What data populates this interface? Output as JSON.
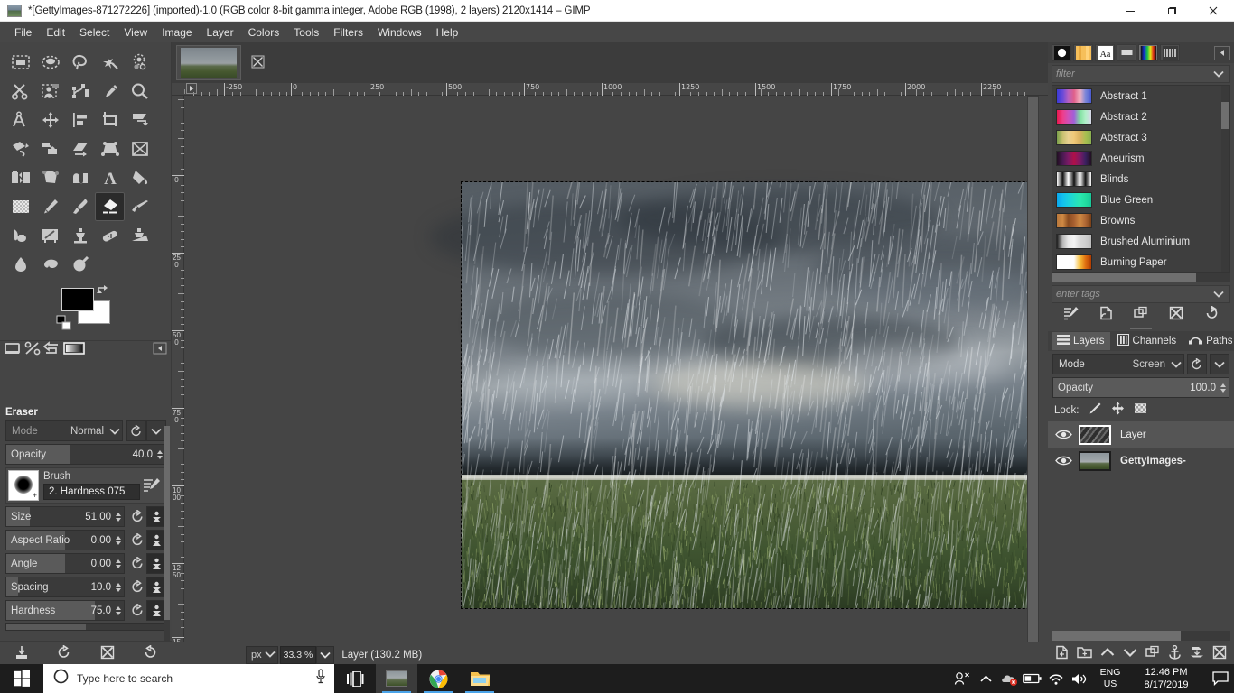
{
  "window": {
    "title": "*[GettyImages-871272226] (imported)-1.0 (RGB color 8-bit gamma integer, Adobe RGB (1998), 2 layers) 2120x1414 – GIMP",
    "minimize": "–",
    "maximize": "❐",
    "close": "✕"
  },
  "menubar": {
    "items": [
      "File",
      "Edit",
      "Select",
      "View",
      "Image",
      "Layer",
      "Colors",
      "Tools",
      "Filters",
      "Windows",
      "Help"
    ]
  },
  "toolbox": {
    "tools": [
      "rectangle-select",
      "ellipse-select",
      "free-select",
      "fuzzy-select",
      "select-by-color",
      "scissors-select",
      "foreground-select",
      "paths",
      "color-picker",
      "zoom",
      "measure",
      "move",
      "alignment",
      "crop",
      "transform",
      "rotate",
      "scale",
      "shear",
      "perspective",
      "3d-transform",
      "flip",
      "cage-transform",
      "warp-transform",
      "text",
      "bucket-fill",
      "gradient",
      "pencil",
      "paintbrush",
      "eraser",
      "airbrush",
      "ink",
      "mypaint-brush",
      "clone",
      "heal",
      "perspective-clone",
      "blur-sharpen",
      "smudge",
      "dodge-burn"
    ],
    "active_tool": "eraser",
    "foreground_color": "#000000",
    "background_color": "#ffffff"
  },
  "tool_options": {
    "title": "Eraser",
    "mode_label": "Mode",
    "mode_value": "Normal",
    "opacity_label": "Opacity",
    "opacity_value": "40.0",
    "opacity_percent": 40,
    "brush_caption": "Brush",
    "brush_name": "2. Hardness 075",
    "sliders": [
      {
        "label": "Size",
        "value": "51.00",
        "percent": 20
      },
      {
        "label": "Aspect Ratio",
        "value": "0.00",
        "percent": 50
      },
      {
        "label": "Angle",
        "value": "0.00",
        "percent": 50
      },
      {
        "label": "Spacing",
        "value": "10.0",
        "percent": 10
      },
      {
        "label": "Hardness",
        "value": "75.0",
        "percent": 75
      }
    ],
    "footer_buttons": [
      "save-tool-preset",
      "restore-tool-preset",
      "delete-tool-preset",
      "reset-tool-options"
    ]
  },
  "canvas": {
    "tab_title": "GettyImages-871272226",
    "ruler_h_labels": [
      "-250",
      "0",
      "250",
      "500",
      "750",
      "1000",
      "1250",
      "1500",
      "1750",
      "2000",
      "2250"
    ],
    "ruler_v_labels": [
      "0",
      "250",
      "500",
      "750",
      "1000",
      "1250",
      "15"
    ],
    "unit": "px",
    "zoom": "33.3 %",
    "status": "Layer (130.2 MB)"
  },
  "gradients_dock": {
    "tabs": [
      "brushes-icon",
      "patterns-icon",
      "fonts-icon",
      "buffers-icon",
      "gradients-icon",
      "palettes-icon"
    ],
    "selected_tab": "gradients-icon",
    "filter_placeholder": "filter",
    "tags_placeholder": "enter tags",
    "items": [
      {
        "name": "Abstract 1",
        "colors": [
          "#3a3ad6",
          "#6a4ad8",
          "#b760c0",
          "#e0608a",
          "#f0b0c0",
          "#7c86d8",
          "#4a5ad0"
        ]
      },
      {
        "name": "Abstract 2",
        "colors": [
          "#e81850",
          "#ee3e8a",
          "#d050b8",
          "#a060d8",
          "#7fe0a0",
          "#b0f0c8",
          "#d8d8e8"
        ]
      },
      {
        "name": "Abstract 3",
        "colors": [
          "#7aa04a",
          "#c8c070",
          "#e8d090",
          "#f0c878",
          "#d8b060",
          "#a8c050",
          "#8ab050"
        ]
      },
      {
        "name": "Aneurism",
        "colors": [
          "#221022",
          "#4a1a52",
          "#7a1a66",
          "#b01048",
          "#7a1a66",
          "#3a2060",
          "#221022"
        ]
      },
      {
        "name": "Blinds",
        "colors": [
          "#ffffff",
          "#101010",
          "#ffffff",
          "#101010",
          "#ffffff",
          "#101010",
          "#ffffff"
        ]
      },
      {
        "name": "Blue Green",
        "colors": [
          "#0aa8ee",
          "#12c0ee",
          "#1ad0e0",
          "#22ddc8",
          "#2ae8b0",
          "#22dda0",
          "#18c898"
        ]
      },
      {
        "name": "Browns",
        "colors": [
          "#b9783c",
          "#cf8a44",
          "#8a4c20",
          "#a86030",
          "#cf8a44",
          "#b06834",
          "#7a4018"
        ]
      },
      {
        "name": "Brushed Aluminium",
        "colors": [
          "#1c1c1c",
          "#b8b8b8",
          "#e8e8e8",
          "#f4f4f4",
          "#d8d8d8",
          "#cfcfcf",
          "#bdbdbd"
        ]
      },
      {
        "name": "Burning Paper",
        "colors": [
          "#ffffff",
          "#ffffff",
          "#ffffff",
          "#fdfdfd",
          "#f8c03a",
          "#e07010",
          "#b03c00"
        ]
      }
    ],
    "footer_buttons": [
      "edit-gradient",
      "new-gradient",
      "duplicate-gradient",
      "delete-gradient",
      "refresh-gradients"
    ]
  },
  "layers_dock": {
    "tabs": [
      {
        "label": "Layers",
        "icon": "layers-icon"
      },
      {
        "label": "Channels",
        "icon": "channels-icon"
      },
      {
        "label": "Paths",
        "icon": "paths-icon"
      }
    ],
    "selected_tab": "Layers",
    "mode_label": "Mode",
    "mode_value": "Screen",
    "opacity_label": "Opacity",
    "opacity_value": "100.0",
    "lock_label": "Lock:",
    "lock_options": [
      "lock-pixels-icon",
      "lock-position-icon",
      "lock-alpha-icon"
    ],
    "layers": [
      {
        "name": "Layer",
        "visible": true,
        "selected": true,
        "bold": false
      },
      {
        "name": "GettyImages-",
        "visible": true,
        "selected": false,
        "bold": true
      }
    ],
    "footer_buttons": [
      "new-layer",
      "new-layer-group",
      "raise-layer",
      "lower-layer",
      "duplicate-layer",
      "anchor-layer",
      "merge-down",
      "delete-layer"
    ]
  },
  "taskbar": {
    "search_placeholder": "Type here to search",
    "buttons": [
      "task-view",
      "gimp",
      "chrome",
      "file-explorer"
    ],
    "language": "ENG",
    "region": "US",
    "time": "12:46 PM",
    "date": "8/17/2019"
  }
}
